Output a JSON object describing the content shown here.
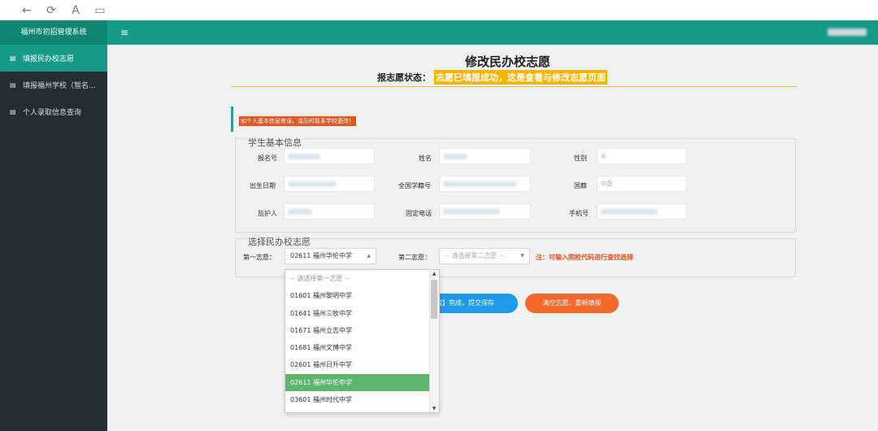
{
  "browser": {
    "back_icon": "←",
    "refresh_icon": "⟳",
    "reader_icon": "A",
    "tabs_icon": "▭"
  },
  "app": {
    "title": "福州市初招管理系统",
    "menu_icon": "≡"
  },
  "sidebar": {
    "items": [
      {
        "icon": "▤",
        "label": "填报民办校志愿",
        "active": true
      },
      {
        "icon": "▤",
        "label": "填报福州学校（暂名...",
        "active": false
      },
      {
        "icon": "▤",
        "label": "个人录取信息查询",
        "active": false
      }
    ]
  },
  "page": {
    "title": "修改民办校志愿",
    "status_label": "报志愿状态：",
    "status_value": "志愿已填报成功，这是查看与修改志愿页面",
    "notice": "如个人基本信息有误，请及时联系学校更改！",
    "basic_info_legend": "学生基本信息",
    "choice_legend": "选择民办校志愿"
  },
  "student_fields": {
    "reg_no_label": "报名号",
    "name_label": "姓名",
    "gender_label": "性别",
    "gender_value": "女",
    "birth_label": "出生日期",
    "national_id_label": "全国学籍号",
    "nationality_label": "国籍",
    "nationality_value": "中国",
    "guardian_label": "监护人",
    "landline_label": "固定电话",
    "mobile_label": "手机号"
  },
  "choices": {
    "first_label": "第一志愿：",
    "first_value": "02611 福州华伦中学",
    "second_label": "第二志愿：",
    "second_placeholder": "-- 请选择第二志愿 --",
    "note": "注：可输入院校代码进行查找选择"
  },
  "dropdown": {
    "options": [
      {
        "label": "-- 请选择第一志愿 --",
        "placeholder": true,
        "selected": false
      },
      {
        "label": "01601 福州黎明中学",
        "placeholder": false,
        "selected": false
      },
      {
        "label": "01641 福州三牧中学",
        "placeholder": false,
        "selected": false
      },
      {
        "label": "01671 福州立志中学",
        "placeholder": false,
        "selected": false
      },
      {
        "label": "01681 福州文博中学",
        "placeholder": false,
        "selected": false
      },
      {
        "label": "02601 福州日升中学",
        "placeholder": false,
        "selected": false
      },
      {
        "label": "02611 福州华伦中学",
        "placeholder": false,
        "selected": true
      },
      {
        "label": "03601 福州时代中学",
        "placeholder": false,
        "selected": false
      }
    ],
    "scroll_up_icon": "▲",
    "scroll_down_icon": "▼"
  },
  "buttons": {
    "submit_label": "校】完成，提交保存",
    "clear_label": "清空志愿，重新填报"
  },
  "colors": {
    "header": "#159a87",
    "sidebar": "#252d34",
    "status_highlight": "#f5b400",
    "notice": "#e55525",
    "submit": "#1e9be8",
    "clear": "#f46a2c",
    "selected_option": "#5cb66b"
  }
}
